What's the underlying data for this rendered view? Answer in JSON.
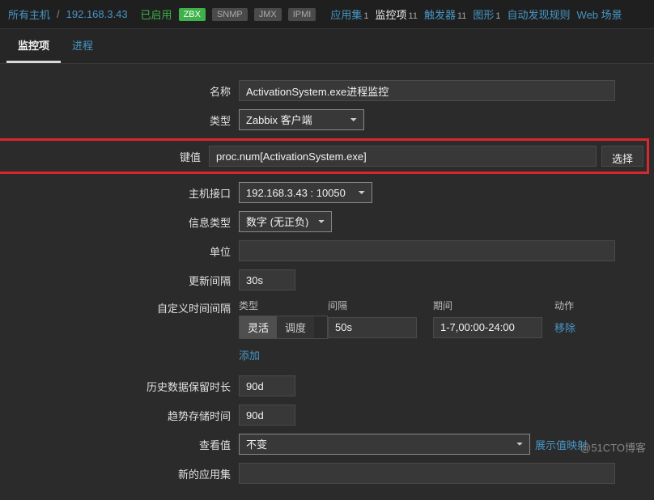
{
  "breadcrumb": {
    "all_hosts": "所有主机",
    "host_ip": "192.168.3.43",
    "status": "已启用"
  },
  "badges": {
    "zbx": "ZBX",
    "snmp": "SNMP",
    "jmx": "JMX",
    "ipmi": "IPMI"
  },
  "nav": {
    "applications": {
      "label": "应用集",
      "count": "1"
    },
    "items": {
      "label": "监控项",
      "count": "11"
    },
    "triggers": {
      "label": "触发器",
      "count": "11"
    },
    "graphs": {
      "label": "图形",
      "count": "1"
    },
    "discovery": {
      "label": "自动发现规则"
    },
    "web": {
      "label": "Web 场景"
    }
  },
  "tabs": {
    "item": "监控项",
    "process": "进程"
  },
  "form": {
    "name": {
      "label": "名称",
      "value": "ActivationSystem.exe进程监控"
    },
    "type": {
      "label": "类型",
      "value": "Zabbix 客户端"
    },
    "key": {
      "label": "键值",
      "value": "proc.num[ActivationSystem.exe]",
      "select_btn": "选择"
    },
    "interface": {
      "label": "主机接口",
      "value": "192.168.3.43 : 10050"
    },
    "info_type": {
      "label": "信息类型",
      "value": "数字 (无正负)"
    },
    "units": {
      "label": "单位",
      "value": ""
    },
    "update_interval": {
      "label": "更新间隔",
      "value": "30s"
    },
    "custom_intervals": {
      "label": "自定义时间间隔",
      "head": {
        "type": "类型",
        "interval": "间隔",
        "period": "期间",
        "action": "动作"
      },
      "type_opts": {
        "flexible": "灵活",
        "scheduling": "调度"
      },
      "interval_value": "50s",
      "period_value": "1-7,00:00-24:00",
      "remove": "移除",
      "add": "添加"
    },
    "history": {
      "label": "历史数据保留时长",
      "value": "90d"
    },
    "trends": {
      "label": "趋势存储时间",
      "value": "90d"
    },
    "show_value": {
      "label": "查看值",
      "value": "不变",
      "link": "展示值映射"
    },
    "new_application": {
      "label": "新的应用集",
      "value": ""
    }
  },
  "watermark": "@51CTO博客"
}
